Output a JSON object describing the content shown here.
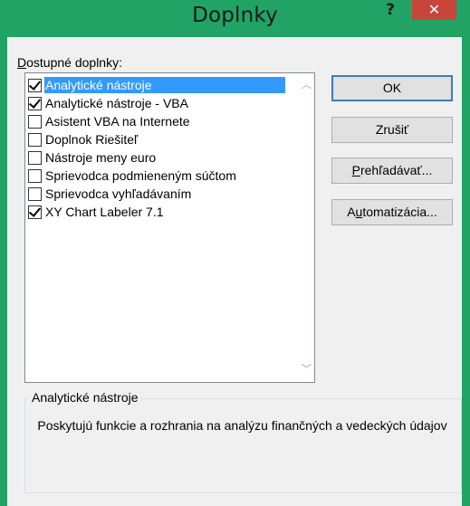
{
  "window": {
    "title": "Doplnky",
    "help_glyph": "?",
    "close_glyph": "✕"
  },
  "list": {
    "label_accel": "D",
    "label_rest": "ostupné doplnky:",
    "items": [
      {
        "label": "Analytické nástroje",
        "checked": true,
        "selected": true
      },
      {
        "label": "Analytické nástroje - VBA",
        "checked": true,
        "selected": false
      },
      {
        "label": "Asistent VBA na Internete",
        "checked": false,
        "selected": false
      },
      {
        "label": "Doplnok Riešiteľ",
        "checked": false,
        "selected": false
      },
      {
        "label": "Nástroje meny euro",
        "checked": false,
        "selected": false
      },
      {
        "label": "Sprievodca podmieneným súčtom",
        "checked": false,
        "selected": false
      },
      {
        "label": "Sprievodca vyhľadávaním",
        "checked": false,
        "selected": false
      },
      {
        "label": "XY Chart Labeler 7.1",
        "checked": true,
        "selected": false
      }
    ],
    "scroll_up_glyph": "︿",
    "scroll_down_glyph": "﹀"
  },
  "buttons": {
    "ok": "OK",
    "cancel": "Zrušiť",
    "browse_accel": "P",
    "browse_rest": "rehľadávať...",
    "automation_pre": "A",
    "automation_accel": "u",
    "automation_rest": "tomatizácia..."
  },
  "description": {
    "title": "Analytické nástroje",
    "text": "Poskytujú funkcie a rozhrania na analýzu finančných a vedeckých údajov"
  },
  "colors": {
    "frame": "#21a366",
    "close": "#c8453c",
    "selection": "#3399ff"
  }
}
